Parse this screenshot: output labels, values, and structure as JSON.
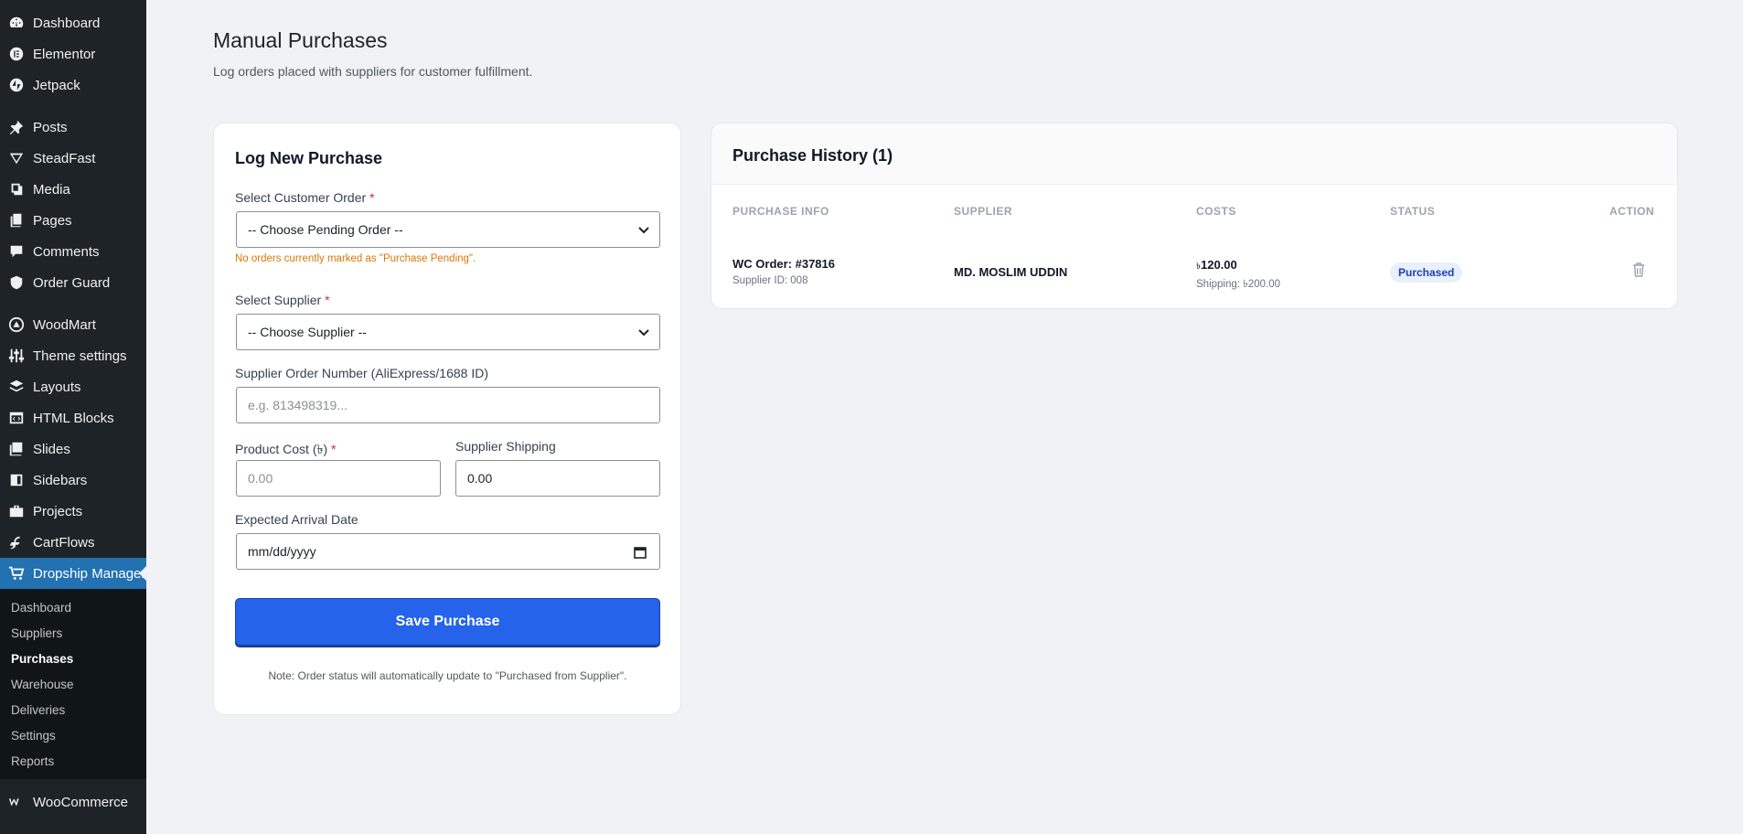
{
  "sidebar": {
    "top": [
      {
        "label": "Dashboard",
        "icon": "dashboard-icon"
      },
      {
        "label": "Elementor",
        "icon": "elementor-icon"
      },
      {
        "label": "Jetpack",
        "icon": "jetpack-icon"
      }
    ],
    "group2": [
      {
        "label": "Posts",
        "icon": "pin-icon"
      },
      {
        "label": "SteadFast",
        "icon": "steadfast-icon"
      },
      {
        "label": "Media",
        "icon": "media-icon"
      },
      {
        "label": "Pages",
        "icon": "pages-icon"
      },
      {
        "label": "Comments",
        "icon": "comment-icon"
      },
      {
        "label": "Order Guard",
        "icon": "shield-icon"
      }
    ],
    "group3": [
      {
        "label": "WoodMart",
        "icon": "woodmart-icon"
      },
      {
        "label": "Theme settings",
        "icon": "sliders-icon"
      },
      {
        "label": "Layouts",
        "icon": "layers-icon"
      },
      {
        "label": "HTML Blocks",
        "icon": "code-icon"
      },
      {
        "label": "Slides",
        "icon": "slides-icon"
      },
      {
        "label": "Sidebars",
        "icon": "sidebar-icon"
      },
      {
        "label": "Projects",
        "icon": "briefcase-icon"
      },
      {
        "label": "CartFlows",
        "icon": "cartflows-icon"
      }
    ],
    "active": {
      "label": "Dropship Manager",
      "icon": "cart-icon"
    },
    "submenu": [
      "Dashboard",
      "Suppliers",
      "Purchases",
      "Warehouse",
      "Deliveries",
      "Settings",
      "Reports"
    ],
    "submenu_current": "Purchases",
    "bottom": {
      "label": "WooCommerce",
      "icon": "woocommerce-icon"
    }
  },
  "page": {
    "title": "Manual Purchases",
    "subtitle": "Log orders placed with suppliers for customer fulfillment."
  },
  "form": {
    "heading": "Log New Purchase",
    "customer_order_label": "Select Customer Order",
    "customer_order_value": "-- Choose Pending Order --",
    "no_orders_warning": "No orders currently marked as \"Purchase Pending\".",
    "supplier_label": "Select Supplier",
    "supplier_value": "-- Choose Supplier --",
    "supplier_order_label": "Supplier Order Number (AliExpress/1688 ID)",
    "supplier_order_placeholder": "e.g. 813498319...",
    "product_cost_label": "Product Cost (৳)",
    "product_cost_placeholder": "0.00",
    "shipping_label": "Supplier Shipping",
    "shipping_value": "0.00",
    "arrival_label": "Expected Arrival Date",
    "arrival_value": "mm/dd/yyyy",
    "required_mark": "*",
    "save_label": "Save Purchase",
    "note": "Note: Order status will automatically update to \"Purchased from Supplier\"."
  },
  "history": {
    "title": "Purchase History (1)",
    "columns": [
      "PURCHASE INFO",
      "SUPPLIER",
      "COSTS",
      "STATUS",
      "ACTION"
    ],
    "rows": [
      {
        "order": "WC Order: #37816",
        "supplier_id": "Supplier ID: 008",
        "supplier": "MD. MOSLIM UDDIN",
        "cost_symbol": "৳",
        "cost": "120.00",
        "shipping": "Shipping: ৳200.00",
        "status": "Purchased"
      }
    ]
  },
  "colors": {
    "accent": "#2563eb",
    "sidebar": "#1d2327",
    "active_menu": "#2271b1",
    "warning": "#d97706"
  }
}
